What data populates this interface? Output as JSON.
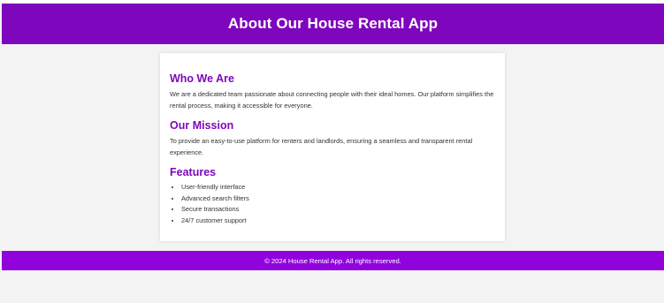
{
  "header": {
    "title": "About Our House Rental App"
  },
  "content": {
    "who": {
      "heading": "Who We Are",
      "text": "We are a dedicated team passionate about connecting people with their ideal homes. Our platform simplifies the rental process, making it accessible for everyone."
    },
    "mission": {
      "heading": "Our Mission",
      "text": "To provide an easy-to-use platform for renters and landlords, ensuring a seamless and transparent rental experience."
    },
    "features": {
      "heading": "Features",
      "items": [
        "User-friendly interface",
        "Advanced search filters",
        "Secure transactions",
        "24/7 customer support"
      ]
    }
  },
  "footer": {
    "text": "© 2024 House Rental App. All rights reserved."
  },
  "colors": {
    "header_bg": "#7e06bd",
    "footer_bg": "#9103dd",
    "heading": "#7e06bd",
    "page_bg": "#f3f3f3"
  }
}
